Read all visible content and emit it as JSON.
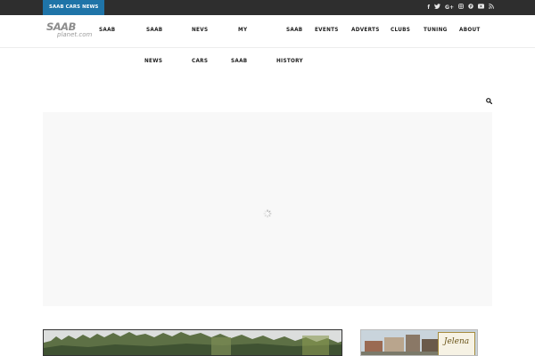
{
  "topbar": {
    "tag": "SAAB CARS NEWS",
    "social_icons": [
      {
        "name": "facebook-icon",
        "glyph": "f"
      },
      {
        "name": "twitter-icon",
        "glyph": "t"
      },
      {
        "name": "google-plus-icon",
        "glyph": "G+"
      },
      {
        "name": "instagram-icon",
        "glyph": "◎"
      },
      {
        "name": "pinterest-icon",
        "glyph": "P"
      },
      {
        "name": "youtube-icon",
        "glyph": "▶"
      },
      {
        "name": "rss-icon",
        "glyph": "◉"
      }
    ]
  },
  "logo": {
    "main": "SAAB",
    "sub": "planet.com"
  },
  "nav": {
    "saab_news": [
      "SAAB",
      "NEWS"
    ],
    "nevs_cars": [
      "NEVS",
      "CARS"
    ],
    "my_saab": [
      "MY",
      "SAAB"
    ],
    "saab_history": [
      "SAAB",
      "HISTORY"
    ],
    "events": "EVENTS",
    "adverts": "ADVERTS",
    "clubs": "CLUBS",
    "tuning": "TUNING",
    "about": "ABOUT"
  },
  "colors": {
    "topbar_bg": "#2e2e2e",
    "tag_bg": "#1f74a8",
    "slider_bg": "#f8f8f8"
  },
  "ad": {
    "brand": "Jelena"
  }
}
